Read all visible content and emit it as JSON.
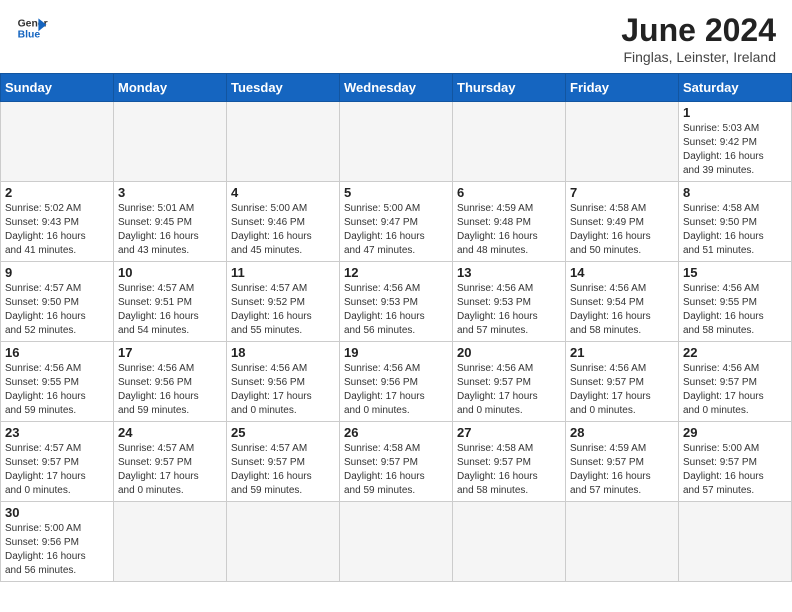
{
  "header": {
    "logo_line1": "General",
    "logo_line2": "Blue",
    "title": "June 2024",
    "subtitle": "Finglas, Leinster, Ireland"
  },
  "days_of_week": [
    "Sunday",
    "Monday",
    "Tuesday",
    "Wednesday",
    "Thursday",
    "Friday",
    "Saturday"
  ],
  "weeks": [
    [
      {
        "num": "",
        "info": ""
      },
      {
        "num": "",
        "info": ""
      },
      {
        "num": "",
        "info": ""
      },
      {
        "num": "",
        "info": ""
      },
      {
        "num": "",
        "info": ""
      },
      {
        "num": "",
        "info": ""
      },
      {
        "num": "1",
        "info": "Sunrise: 5:03 AM\nSunset: 9:42 PM\nDaylight: 16 hours\nand 39 minutes."
      }
    ],
    [
      {
        "num": "2",
        "info": "Sunrise: 5:02 AM\nSunset: 9:43 PM\nDaylight: 16 hours\nand 41 minutes."
      },
      {
        "num": "3",
        "info": "Sunrise: 5:01 AM\nSunset: 9:45 PM\nDaylight: 16 hours\nand 43 minutes."
      },
      {
        "num": "4",
        "info": "Sunrise: 5:00 AM\nSunset: 9:46 PM\nDaylight: 16 hours\nand 45 minutes."
      },
      {
        "num": "5",
        "info": "Sunrise: 5:00 AM\nSunset: 9:47 PM\nDaylight: 16 hours\nand 47 minutes."
      },
      {
        "num": "6",
        "info": "Sunrise: 4:59 AM\nSunset: 9:48 PM\nDaylight: 16 hours\nand 48 minutes."
      },
      {
        "num": "7",
        "info": "Sunrise: 4:58 AM\nSunset: 9:49 PM\nDaylight: 16 hours\nand 50 minutes."
      },
      {
        "num": "8",
        "info": "Sunrise: 4:58 AM\nSunset: 9:50 PM\nDaylight: 16 hours\nand 51 minutes."
      }
    ],
    [
      {
        "num": "9",
        "info": "Sunrise: 4:57 AM\nSunset: 9:50 PM\nDaylight: 16 hours\nand 52 minutes."
      },
      {
        "num": "10",
        "info": "Sunrise: 4:57 AM\nSunset: 9:51 PM\nDaylight: 16 hours\nand 54 minutes."
      },
      {
        "num": "11",
        "info": "Sunrise: 4:57 AM\nSunset: 9:52 PM\nDaylight: 16 hours\nand 55 minutes."
      },
      {
        "num": "12",
        "info": "Sunrise: 4:56 AM\nSunset: 9:53 PM\nDaylight: 16 hours\nand 56 minutes."
      },
      {
        "num": "13",
        "info": "Sunrise: 4:56 AM\nSunset: 9:53 PM\nDaylight: 16 hours\nand 57 minutes."
      },
      {
        "num": "14",
        "info": "Sunrise: 4:56 AM\nSunset: 9:54 PM\nDaylight: 16 hours\nand 58 minutes."
      },
      {
        "num": "15",
        "info": "Sunrise: 4:56 AM\nSunset: 9:55 PM\nDaylight: 16 hours\nand 58 minutes."
      }
    ],
    [
      {
        "num": "16",
        "info": "Sunrise: 4:56 AM\nSunset: 9:55 PM\nDaylight: 16 hours\nand 59 minutes."
      },
      {
        "num": "17",
        "info": "Sunrise: 4:56 AM\nSunset: 9:56 PM\nDaylight: 16 hours\nand 59 minutes."
      },
      {
        "num": "18",
        "info": "Sunrise: 4:56 AM\nSunset: 9:56 PM\nDaylight: 17 hours\nand 0 minutes."
      },
      {
        "num": "19",
        "info": "Sunrise: 4:56 AM\nSunset: 9:56 PM\nDaylight: 17 hours\nand 0 minutes."
      },
      {
        "num": "20",
        "info": "Sunrise: 4:56 AM\nSunset: 9:57 PM\nDaylight: 17 hours\nand 0 minutes."
      },
      {
        "num": "21",
        "info": "Sunrise: 4:56 AM\nSunset: 9:57 PM\nDaylight: 17 hours\nand 0 minutes."
      },
      {
        "num": "22",
        "info": "Sunrise: 4:56 AM\nSunset: 9:57 PM\nDaylight: 17 hours\nand 0 minutes."
      }
    ],
    [
      {
        "num": "23",
        "info": "Sunrise: 4:57 AM\nSunset: 9:57 PM\nDaylight: 17 hours\nand 0 minutes."
      },
      {
        "num": "24",
        "info": "Sunrise: 4:57 AM\nSunset: 9:57 PM\nDaylight: 17 hours\nand 0 minutes."
      },
      {
        "num": "25",
        "info": "Sunrise: 4:57 AM\nSunset: 9:57 PM\nDaylight: 16 hours\nand 59 minutes."
      },
      {
        "num": "26",
        "info": "Sunrise: 4:58 AM\nSunset: 9:57 PM\nDaylight: 16 hours\nand 59 minutes."
      },
      {
        "num": "27",
        "info": "Sunrise: 4:58 AM\nSunset: 9:57 PM\nDaylight: 16 hours\nand 58 minutes."
      },
      {
        "num": "28",
        "info": "Sunrise: 4:59 AM\nSunset: 9:57 PM\nDaylight: 16 hours\nand 57 minutes."
      },
      {
        "num": "29",
        "info": "Sunrise: 5:00 AM\nSunset: 9:57 PM\nDaylight: 16 hours\nand 57 minutes."
      }
    ],
    [
      {
        "num": "30",
        "info": "Sunrise: 5:00 AM\nSunset: 9:56 PM\nDaylight: 16 hours\nand 56 minutes."
      },
      {
        "num": "",
        "info": ""
      },
      {
        "num": "",
        "info": ""
      },
      {
        "num": "",
        "info": ""
      },
      {
        "num": "",
        "info": ""
      },
      {
        "num": "",
        "info": ""
      },
      {
        "num": "",
        "info": ""
      }
    ]
  ]
}
